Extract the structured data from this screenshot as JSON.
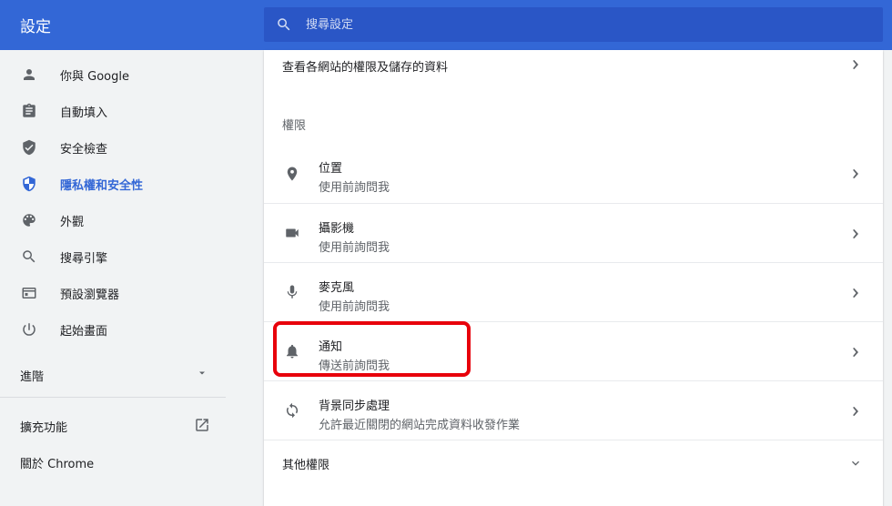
{
  "header": {
    "title": "設定",
    "search_placeholder": "搜尋設定"
  },
  "sidebar": {
    "items": [
      {
        "label": "你與 Google",
        "icon": "person-icon"
      },
      {
        "label": "自動填入",
        "icon": "clipboard-icon"
      },
      {
        "label": "安全檢查",
        "icon": "shield-check-icon"
      },
      {
        "label": "隱私權和安全性",
        "icon": "privacy-shield-icon",
        "active": true
      },
      {
        "label": "外觀",
        "icon": "palette-icon"
      },
      {
        "label": "搜尋引擎",
        "icon": "search-icon"
      },
      {
        "label": "預設瀏覽器",
        "icon": "browser-window-icon"
      },
      {
        "label": "起始畫面",
        "icon": "power-icon"
      }
    ],
    "advanced": "進階",
    "extensions": "擴充功能",
    "about": "關於 Chrome"
  },
  "main": {
    "view_all_sites": "查看各網站的權限及儲存的資料",
    "permissions_heading": "權限",
    "permissions": [
      {
        "title": "位置",
        "subtitle": "使用前詢問我",
        "icon": "location-pin-icon"
      },
      {
        "title": "攝影機",
        "subtitle": "使用前詢問我",
        "icon": "camera-icon"
      },
      {
        "title": "麥克風",
        "subtitle": "使用前詢問我",
        "icon": "microphone-icon"
      },
      {
        "title": "通知",
        "subtitle": "傳送前詢問我",
        "icon": "bell-icon"
      },
      {
        "title": "背景同步處理",
        "subtitle": "允許最近關閉的網站完成資料收發作業",
        "icon": "sync-icon"
      }
    ],
    "more_permissions": "其他權限"
  },
  "colors": {
    "header": "#3367d6",
    "search_bg": "#2a56c6",
    "active": "#3367d6",
    "highlight": "#e8000b"
  }
}
